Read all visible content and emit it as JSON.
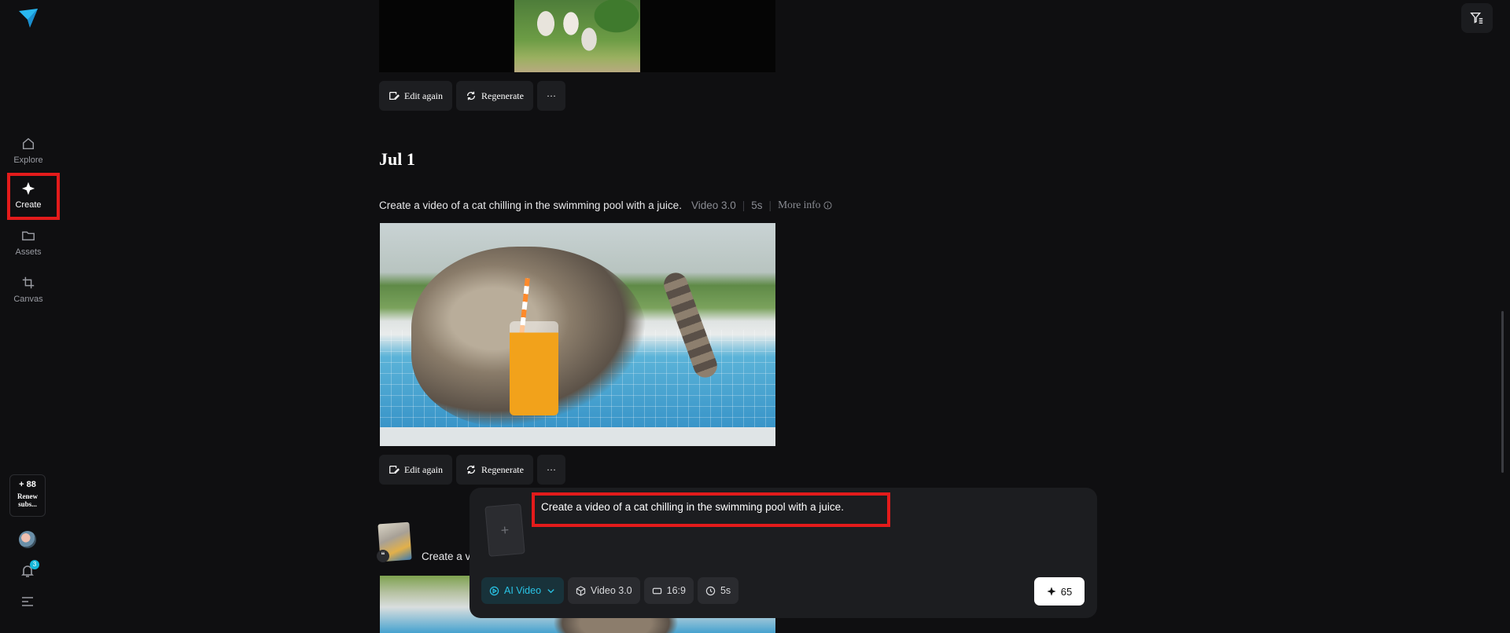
{
  "sidebar": {
    "logo_icon": "paper-plane-logo-icon",
    "items": [
      {
        "label": "Explore",
        "icon": "home-icon"
      },
      {
        "label": "Create",
        "icon": "sparkle-icon",
        "active": true
      },
      {
        "label": "Assets",
        "icon": "folder-icon"
      },
      {
        "label": "Canvas",
        "icon": "crop-icon"
      }
    ],
    "credits": {
      "count": "+ 88",
      "renew": "Renew subs..."
    },
    "notification_count": "3"
  },
  "feed": {
    "actions": {
      "edit_again": "Edit again",
      "regenerate": "Regenerate",
      "more": "···"
    },
    "date_heading": "Jul 1",
    "entry": {
      "prompt": "Create a video of a cat chilling in the swimming pool with a juice.",
      "model": "Video 3.0",
      "duration": "5s",
      "more_info": "More info"
    },
    "next_entry_prompt": "Create a v"
  },
  "composer": {
    "prompt_value": "Create a video of a cat chilling in the swimming pool  with  a juice.",
    "upload_symbol": "+",
    "mode": "AI Video",
    "model": "Video 3.0",
    "aspect": "16:9",
    "duration": "5s",
    "generate_cost": "65"
  },
  "colors": {
    "background": "#0f0f11",
    "accent": "#29c4e6",
    "highlight_box": "#e31b1b"
  }
}
